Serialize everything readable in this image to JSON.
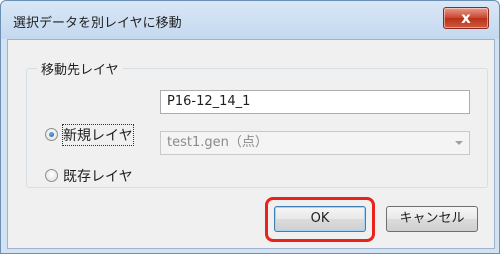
{
  "window": {
    "title": "選択データを別レイヤに移動",
    "close_label": "x"
  },
  "group": {
    "legend": "移動先レイヤ",
    "option_new": {
      "label": "新規レイヤ",
      "checked": true,
      "value": "P16-12_14_1"
    },
    "option_existing": {
      "label": "既存レイヤ",
      "checked": false,
      "selected": "test1.gen（点）"
    }
  },
  "buttons": {
    "ok": "OK",
    "cancel": "キャンセル"
  },
  "colors": {
    "highlight": "#e8231b",
    "close_button": "#c9442e"
  }
}
